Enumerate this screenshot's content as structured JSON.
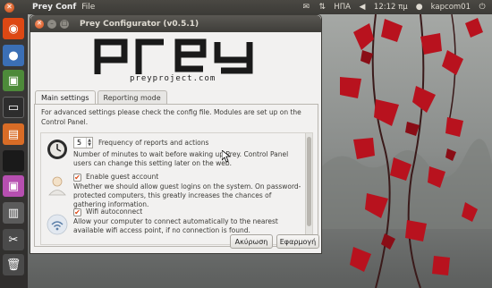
{
  "top_panel": {
    "app_name": "Prey Conf",
    "menu_file": "File",
    "keyboard": "ΗΠΑ",
    "time": "12:12 πμ",
    "user": "kapcom01"
  },
  "window": {
    "title": "Prey Configurator (v0.5.1)"
  },
  "logo": {
    "url_text": "preyproject.com"
  },
  "tabs": [
    {
      "label": "Main settings",
      "active": true
    },
    {
      "label": "Reporting mode",
      "active": false
    }
  ],
  "main_settings": {
    "intro": "For advanced settings please check the config file. Modules are set up on the Control Panel.",
    "frequency": {
      "value": "5",
      "label": "Frequency of reports and actions",
      "description": "Number of minutes to wait before waking up Prey. Control Panel users can change this setting later on the web."
    },
    "guest": {
      "checked": true,
      "label": "Enable guest account",
      "description": "Whether we should allow guest logins on the system. On password-protected computers, this greatly increases the chances of gathering information."
    },
    "wifi": {
      "checked": true,
      "label": "Wifi autoconnect",
      "description": "Allow your computer to connect automatically to the nearest available wifi access point, if no connection is found."
    }
  },
  "buttons": {
    "cancel": "Ακύρωση",
    "apply": "Εφαρμογή"
  },
  "colors": {
    "accent": "#dd4814",
    "panel": "#3c3b37",
    "window_bg": "#f2f1f0"
  }
}
